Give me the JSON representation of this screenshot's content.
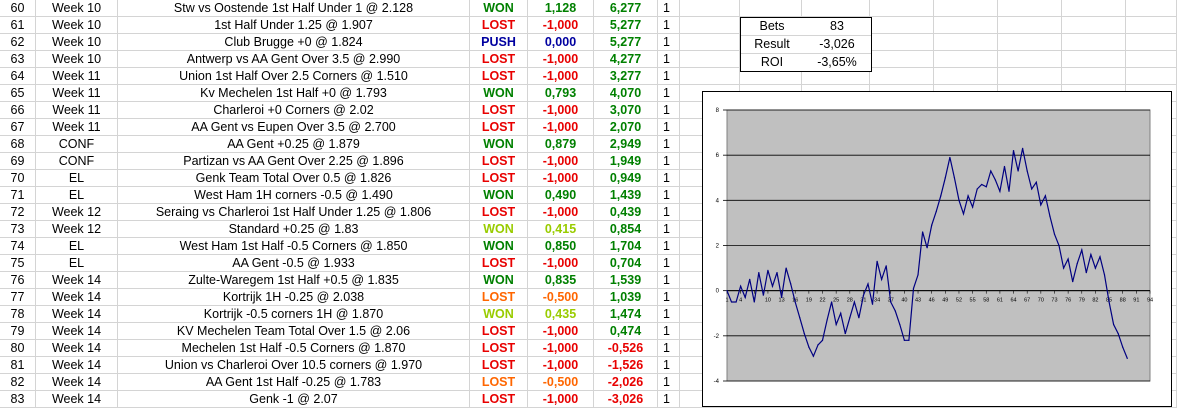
{
  "rows": [
    {
      "n": "60",
      "week": "Week 10",
      "desc": "Stw vs Oostende 1st Half Under 1 @ 2.128",
      "res": "WON",
      "rescls": "won",
      "pnl": "1,128",
      "pnlcls": "won",
      "tot": "6,277",
      "totcls": "pos",
      "one": "1"
    },
    {
      "n": "61",
      "week": "Week 10",
      "desc": "1st Half Under 1.25 @ 1.907",
      "res": "LOST",
      "rescls": "lost",
      "pnl": "-1,000",
      "pnlcls": "lost",
      "tot": "5,277",
      "totcls": "pos",
      "one": "1"
    },
    {
      "n": "62",
      "week": "Week 10",
      "desc": "Club Brugge +0 @ 1.824",
      "res": "PUSH",
      "rescls": "push",
      "pnl": "0,000",
      "pnlcls": "zero",
      "tot": "5,277",
      "totcls": "pos",
      "one": "1"
    },
    {
      "n": "63",
      "week": "Week 10",
      "desc": "Antwerp vs AA Gent Over 3.5 @ 2.990",
      "res": "LOST",
      "rescls": "lost",
      "pnl": "-1,000",
      "pnlcls": "lost",
      "tot": "4,277",
      "totcls": "pos",
      "one": "1"
    },
    {
      "n": "64",
      "week": "Week 11",
      "desc": "Union 1st Half Over 2.5 Corners @ 1.510",
      "res": "LOST",
      "rescls": "lost",
      "pnl": "-1,000",
      "pnlcls": "lost",
      "tot": "3,277",
      "totcls": "pos",
      "one": "1"
    },
    {
      "n": "65",
      "week": "Week 11",
      "desc": "Kv Mechelen 1st Half +0 @ 1.793",
      "res": "WON",
      "rescls": "won",
      "pnl": "0,793",
      "pnlcls": "won",
      "tot": "4,070",
      "totcls": "pos",
      "one": "1"
    },
    {
      "n": "66",
      "week": "Week 11",
      "desc": "Charleroi +0 Corners @ 2.02",
      "res": "LOST",
      "rescls": "lost",
      "pnl": "-1,000",
      "pnlcls": "lost",
      "tot": "3,070",
      "totcls": "pos",
      "one": "1"
    },
    {
      "n": "67",
      "week": "Week 11",
      "desc": "AA Gent vs Eupen Over 3.5 @ 2.700",
      "res": "LOST",
      "rescls": "lost",
      "pnl": "-1,000",
      "pnlcls": "lost",
      "tot": "2,070",
      "totcls": "pos",
      "one": "1"
    },
    {
      "n": "68",
      "week": "CONF",
      "desc": "AA Gent +0.25 @ 1.879",
      "res": "WON",
      "rescls": "won",
      "pnl": "0,879",
      "pnlcls": "won",
      "tot": "2,949",
      "totcls": "pos",
      "one": "1"
    },
    {
      "n": "69",
      "week": "CONF",
      "desc": "Partizan vs AA Gent Over 2.25 @ 1.896",
      "res": "LOST",
      "rescls": "lost",
      "pnl": "-1,000",
      "pnlcls": "lost",
      "tot": "1,949",
      "totcls": "pos",
      "one": "1"
    },
    {
      "n": "70",
      "week": "EL",
      "desc": "Genk Team Total Over 0.5 @ 1.826",
      "res": "LOST",
      "rescls": "lost",
      "pnl": "-1,000",
      "pnlcls": "lost",
      "tot": "0,949",
      "totcls": "pos",
      "one": "1"
    },
    {
      "n": "71",
      "week": "EL",
      "desc": "West Ham 1H corners -0.5 @ 1.490",
      "res": "WON",
      "rescls": "won",
      "pnl": "0,490",
      "pnlcls": "won",
      "tot": "1,439",
      "totcls": "pos",
      "one": "1"
    },
    {
      "n": "72",
      "week": "Week 12",
      "desc": "Seraing vs Charleroi 1st Half Under 1.25 @ 1.806",
      "res": "LOST",
      "rescls": "lost",
      "pnl": "-1,000",
      "pnlcls": "lost",
      "tot": "0,439",
      "totcls": "pos",
      "one": "1"
    },
    {
      "n": "73",
      "week": "Week 12",
      "desc": "Standard +0.25 @ 1.83",
      "res": "WON",
      "rescls": "wonlight",
      "pnl": "0,415",
      "pnlcls": "wonlight",
      "tot": "0,854",
      "totcls": "pos",
      "one": "1"
    },
    {
      "n": "74",
      "week": "EL",
      "desc": "West Ham 1st Half -0.5 Corners @ 1.850",
      "res": "WON",
      "rescls": "won",
      "pnl": "0,850",
      "pnlcls": "won",
      "tot": "1,704",
      "totcls": "pos",
      "one": "1"
    },
    {
      "n": "75",
      "week": "EL",
      "desc": "AA Gent -0.5 @ 1.933",
      "res": "LOST",
      "rescls": "lost",
      "pnl": "-1,000",
      "pnlcls": "lost",
      "tot": "0,704",
      "totcls": "pos",
      "one": "1"
    },
    {
      "n": "76",
      "week": "Week 14",
      "desc": "Zulte-Waregem 1st Half +0.5 @ 1.835",
      "res": "WON",
      "rescls": "won",
      "pnl": "0,835",
      "pnlcls": "won",
      "tot": "1,539",
      "totcls": "pos",
      "one": "1"
    },
    {
      "n": "77",
      "week": "Week 14",
      "desc": "Kortrijk 1H -0.25 @ 2.038",
      "res": "LOST",
      "rescls": "lostorange",
      "pnl": "-0,500",
      "pnlcls": "lostorange",
      "tot": "1,039",
      "totcls": "pos",
      "one": "1"
    },
    {
      "n": "78",
      "week": "Week 14",
      "desc": "Kortrijk -0.5 corners 1H @ 1.870",
      "res": "WON",
      "rescls": "wonlight",
      "pnl": "0,435",
      "pnlcls": "wonlight",
      "tot": "1,474",
      "totcls": "pos",
      "one": "1"
    },
    {
      "n": "79",
      "week": "Week 14",
      "desc": "KV Mechelen Team Total Over 1.5 @ 2.06",
      "res": "LOST",
      "rescls": "lost",
      "pnl": "-1,000",
      "pnlcls": "lost",
      "tot": "0,474",
      "totcls": "pos",
      "one": "1"
    },
    {
      "n": "80",
      "week": "Week 14",
      "desc": "Mechelen 1st Half -0.5 Corners @ 1.870",
      "res": "LOST",
      "rescls": "lost",
      "pnl": "-1,000",
      "pnlcls": "lost",
      "tot": "-0,526",
      "totcls": "neg",
      "one": "1"
    },
    {
      "n": "81",
      "week": "Week 14",
      "desc": "Union vs Charleroi Over 10.5 corners @ 1.970",
      "res": "LOST",
      "rescls": "lost",
      "pnl": "-1,000",
      "pnlcls": "lost",
      "tot": "-1,526",
      "totcls": "neg",
      "one": "1"
    },
    {
      "n": "82",
      "week": "Week 14",
      "desc": "AA Gent 1st Half -0.25 @ 1.783",
      "res": "LOST",
      "rescls": "lostorange",
      "pnl": "-0,500",
      "pnlcls": "lostorange",
      "tot": "-2,026",
      "totcls": "neg",
      "one": "1"
    },
    {
      "n": "83",
      "week": "Week 14",
      "desc": "Genk -1 @ 2.07",
      "res": "LOST",
      "rescls": "lost",
      "pnl": "-1,000",
      "pnlcls": "lost",
      "tot": "-3,026",
      "totcls": "neg",
      "one": "1"
    }
  ],
  "stats": {
    "bets_label": "Bets",
    "bets_value": "83",
    "result_label": "Result",
    "result_value": "-3,026",
    "roi_label": "ROI",
    "roi_value": "-3,65%"
  },
  "colors": {
    "won": "#008000",
    "lost": "#e80000",
    "push": "#0000a0",
    "wonlight": "#99cc00",
    "lostorange": "#ff6600",
    "plot_bg": "#c0c0c0",
    "line": "#000080"
  },
  "chart_data": {
    "type": "line",
    "title": "",
    "xlabel": "",
    "ylabel": "",
    "ylim": [
      -4,
      8
    ],
    "xlim": [
      1,
      94
    ],
    "grid": true,
    "y_ticks": [
      "8",
      "6",
      "4",
      "2",
      "0",
      "-2",
      "-4"
    ],
    "x_ticks": [
      "1",
      "4",
      "7",
      "10",
      "13",
      "16",
      "19",
      "22",
      "25",
      "28",
      "31",
      "34",
      "37",
      "40",
      "43",
      "46",
      "49",
      "52",
      "55",
      "58",
      "61",
      "64",
      "67",
      "70",
      "73",
      "76",
      "79",
      "82",
      "85",
      "88",
      "91",
      "94"
    ],
    "series": [
      {
        "values": [
          0,
          -0.5,
          -0.5,
          0.2,
          -0.3,
          0.5,
          -0.5,
          0.8,
          -0.2,
          0.9,
          0.2,
          0.8,
          -0.3,
          1.0,
          0.3,
          -0.5,
          -1.2,
          -1.9,
          -2.5,
          -2.9,
          -2.4,
          -2.2,
          -1.3,
          -0.5,
          -1.5,
          -1.0,
          -1.9,
          -1.2,
          -0.5,
          -1.2,
          -0.2,
          0.3,
          -0.6,
          1.3,
          0.5,
          1.1,
          -0.5,
          -0.9,
          -1.5,
          -2.2,
          -2.2,
          0.1,
          0.7,
          2.6,
          1.9,
          2.9,
          3.5,
          4.2,
          5.0,
          5.9,
          5.0,
          4.0,
          3.4,
          4.2,
          3.7,
          4.5,
          4.7,
          4.6,
          5.3,
          4.9,
          4.4,
          5.5,
          4.4,
          6.2,
          5.3,
          6.3,
          5.3,
          4.5,
          4.8,
          3.8,
          4.2,
          3.3,
          2.5,
          2.0,
          1.0,
          1.4,
          0.4,
          1.2,
          1.8,
          0.8,
          1.6,
          1.0,
          1.5,
          0.7,
          -0.5,
          -1.5,
          -1.9,
          -2.5,
          -3.0
        ]
      }
    ]
  }
}
